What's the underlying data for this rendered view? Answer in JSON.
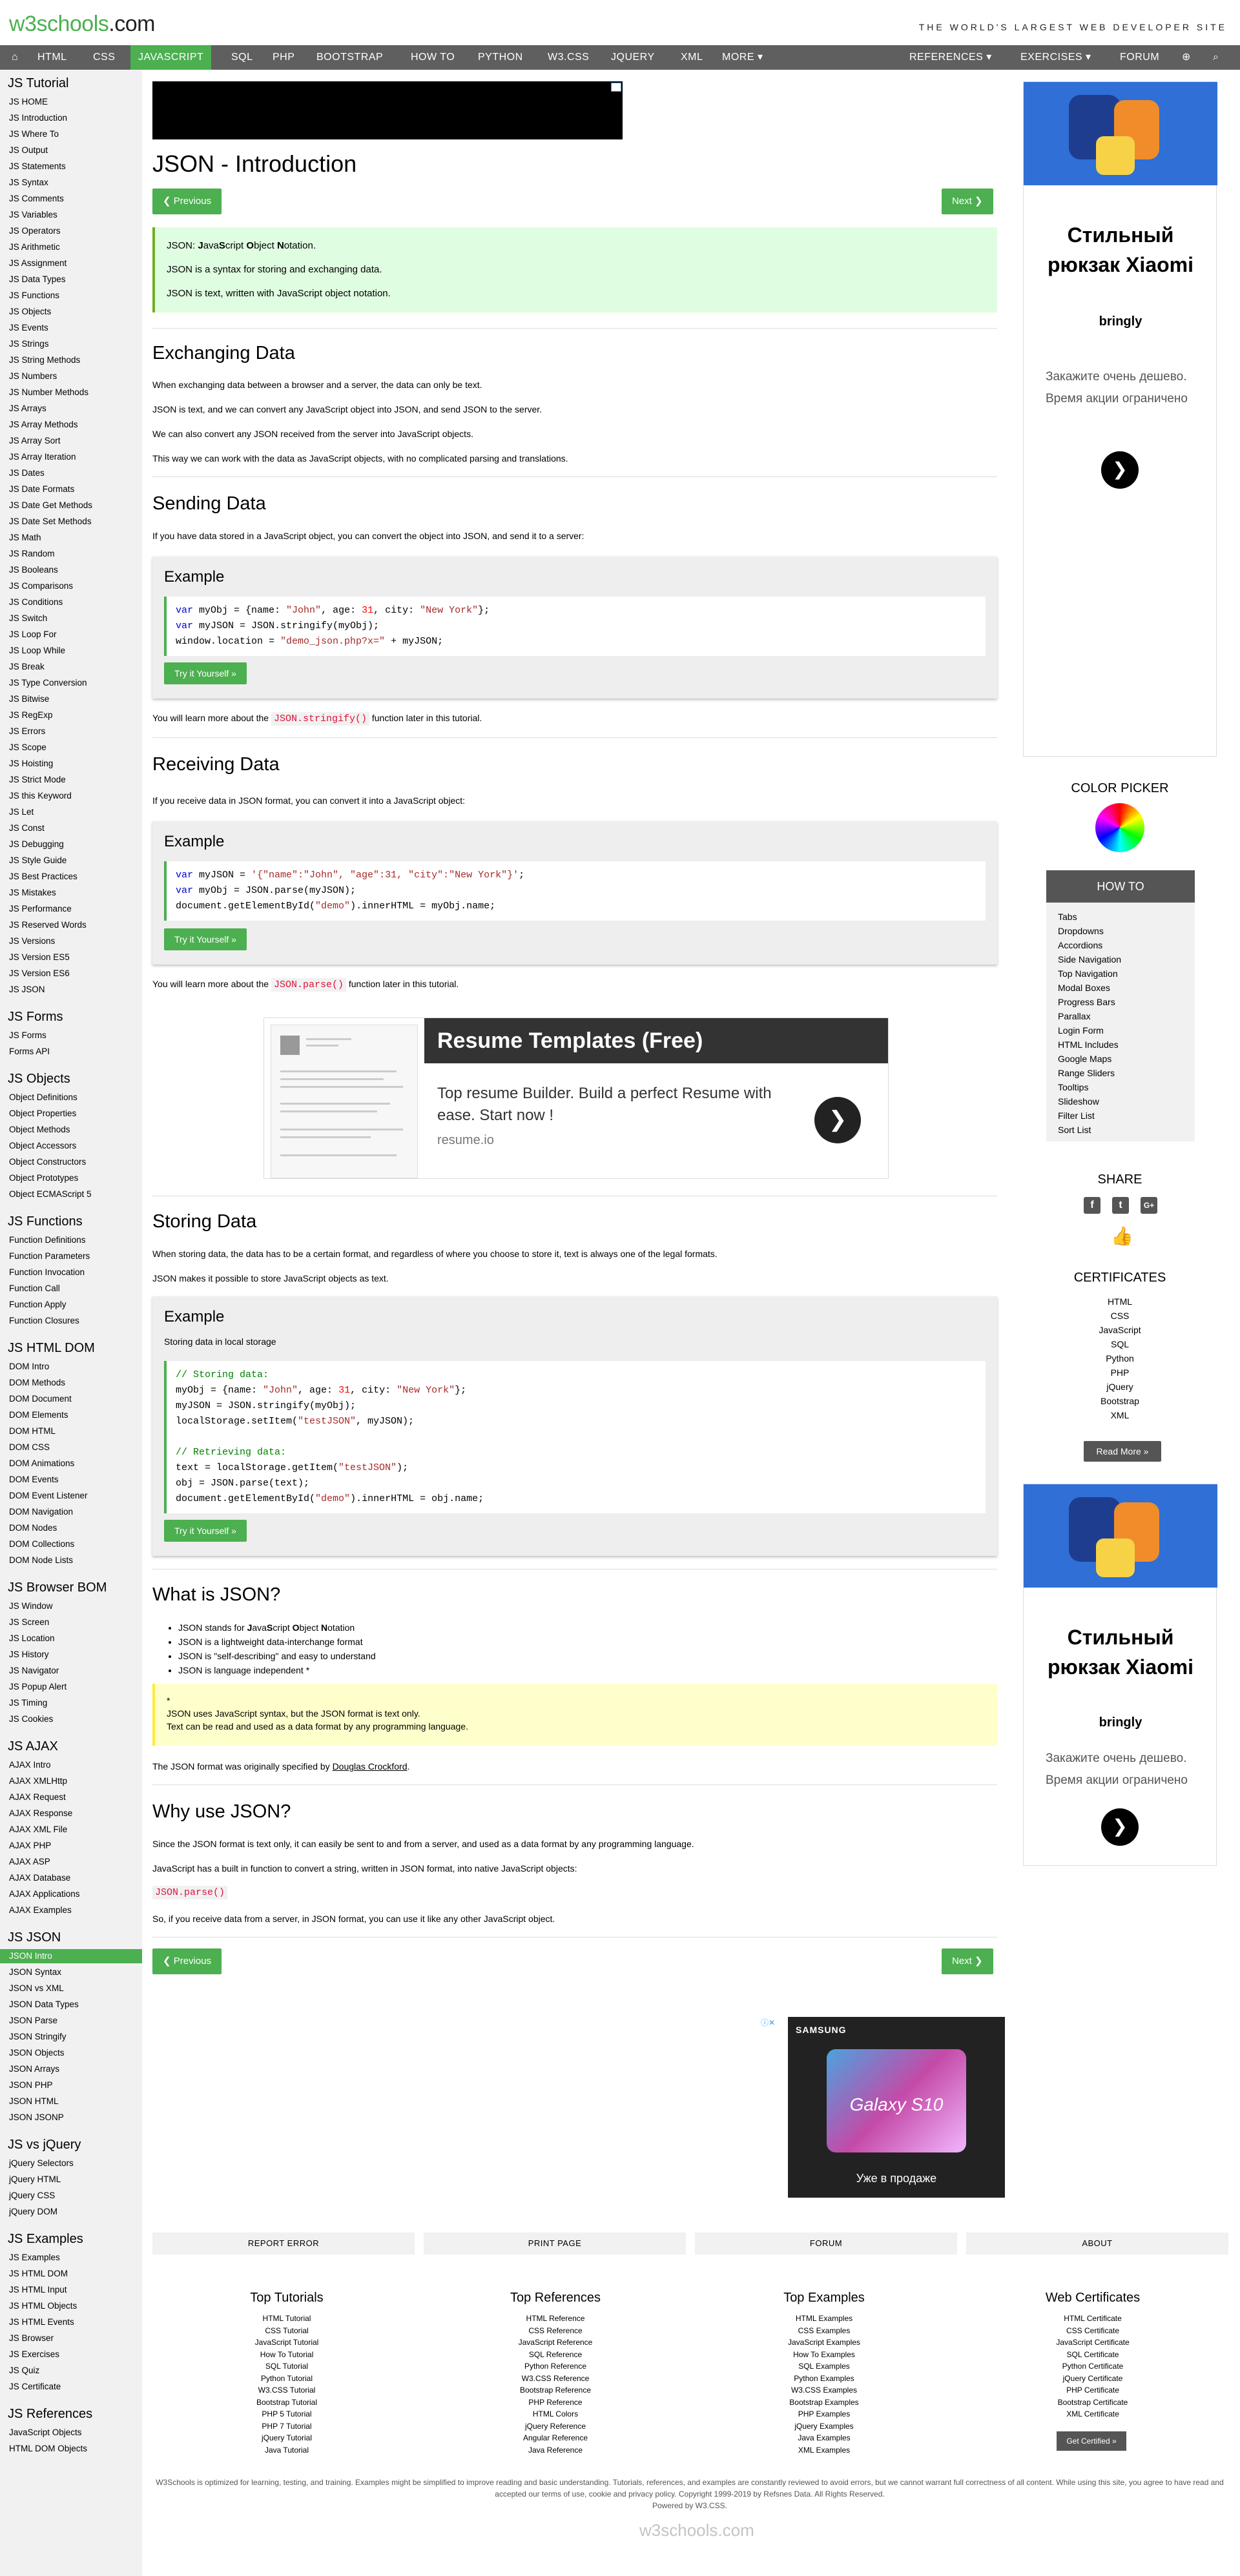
{
  "header": {
    "logo_main": "w3schools",
    "logo_suffix": ".com",
    "slogan": "THE WORLD'S LARGEST WEB DEVELOPER SITE"
  },
  "nav": {
    "home_icon": "⌂",
    "items": [
      "HTML",
      "CSS",
      "JAVASCRIPT",
      "SQL",
      "PHP",
      "BOOTSTRAP",
      "HOW TO",
      "PYTHON",
      "W3.CSS",
      "JQUERY",
      "XML",
      "MORE ▾"
    ],
    "right_items": [
      "REFERENCES ▾",
      "EXERCISES ▾",
      "FORUM"
    ],
    "globe_icon": "⊕",
    "search_icon": "⌕"
  },
  "sidebar": {
    "sections": [
      {
        "title": "JS Tutorial",
        "links": [
          "JS HOME",
          "JS Introduction",
          "JS Where To",
          "JS Output",
          "JS Statements",
          "JS Syntax",
          "JS Comments",
          "JS Variables",
          "JS Operators",
          "JS Arithmetic",
          "JS Assignment",
          "JS Data Types",
          "JS Functions",
          "JS Objects",
          "JS Events",
          "JS Strings",
          "JS String Methods",
          "JS Numbers",
          "JS Number Methods",
          "JS Arrays",
          "JS Array Methods",
          "JS Array Sort",
          "JS Array Iteration",
          "JS Dates",
          "JS Date Formats",
          "JS Date Get Methods",
          "JS Date Set Methods",
          "JS Math",
          "JS Random",
          "JS Booleans",
          "JS Comparisons",
          "JS Conditions",
          "JS Switch",
          "JS Loop For",
          "JS Loop While",
          "JS Break",
          "JS Type Conversion",
          "JS Bitwise",
          "JS RegExp",
          "JS Errors",
          "JS Scope",
          "JS Hoisting",
          "JS Strict Mode",
          "JS this Keyword",
          "JS Let",
          "JS Const",
          "JS Debugging",
          "JS Style Guide",
          "JS Best Practices",
          "JS Mistakes",
          "JS Performance",
          "JS Reserved Words",
          "JS Versions",
          "JS Version ES5",
          "JS Version ES6",
          "JS JSON"
        ]
      },
      {
        "title": "JS Forms",
        "links": [
          "JS Forms",
          "Forms API"
        ]
      },
      {
        "title": "JS Objects",
        "links": [
          "Object Definitions",
          "Object Properties",
          "Object Methods",
          "Object Accessors",
          "Object Constructors",
          "Object Prototypes",
          "Object ECMAScript 5"
        ]
      },
      {
        "title": "JS Functions",
        "links": [
          "Function Definitions",
          "Function Parameters",
          "Function Invocation",
          "Function Call",
          "Function Apply",
          "Function Closures"
        ]
      },
      {
        "title": "JS HTML DOM",
        "links": [
          "DOM Intro",
          "DOM Methods",
          "DOM Document",
          "DOM Elements",
          "DOM HTML",
          "DOM CSS",
          "DOM Animations",
          "DOM Events",
          "DOM Event Listener",
          "DOM Navigation",
          "DOM Nodes",
          "DOM Collections",
          "DOM Node Lists"
        ]
      },
      {
        "title": "JS Browser BOM",
        "links": [
          "JS Window",
          "JS Screen",
          "JS Location",
          "JS History",
          "JS Navigator",
          "JS Popup Alert",
          "JS Timing",
          "JS Cookies"
        ]
      },
      {
        "title": "JS AJAX",
        "links": [
          "AJAX Intro",
          "AJAX XMLHttp",
          "AJAX Request",
          "AJAX Response",
          "AJAX XML File",
          "AJAX PHP",
          "AJAX ASP",
          "AJAX Database",
          "AJAX Applications",
          "AJAX Examples"
        ]
      },
      {
        "title": "JS JSON",
        "links": [
          "JSON Intro",
          "JSON Syntax",
          "JSON vs XML",
          "JSON Data Types",
          "JSON Parse",
          "JSON Stringify",
          "JSON Objects",
          "JSON Arrays",
          "JSON PHP",
          "JSON HTML",
          "JSON JSONP"
        ]
      },
      {
        "title": "JS vs jQuery",
        "links": [
          "jQuery Selectors",
          "jQuery HTML",
          "jQuery CSS",
          "jQuery DOM"
        ]
      },
      {
        "title": "JS Examples",
        "links": [
          "JS Examples",
          "JS HTML DOM",
          "JS HTML Input",
          "JS HTML Objects",
          "JS HTML Events",
          "JS Browser",
          "JS Exercises",
          "JS Quiz",
          "JS Certificate"
        ]
      },
      {
        "title": "JS References",
        "links": [
          "JavaScript Objects",
          "HTML DOM Objects"
        ]
      }
    ],
    "active": "JSON Intro"
  },
  "main": {
    "title": "JSON - Introduction",
    "prev": "❮ Previous",
    "next": "Next ❯",
    "note": {
      "line1_parts": [
        "JSON: ",
        "J",
        "ava",
        "S",
        "cript ",
        "O",
        "bject ",
        "N",
        "otation."
      ],
      "line2": "JSON is a syntax for storing and exchanging data.",
      "line3": "JSON is text, written with JavaScript object notation."
    },
    "exchanging": {
      "title": "Exchanging Data",
      "p1": "When exchanging data between a browser and a server, the data can only be text.",
      "p2": "JSON is text, and we can convert any JavaScript object into JSON, and send JSON to the server.",
      "p3": "We can also convert any JSON received from the server into JavaScript objects.",
      "p4": "This way we can work with the data as JavaScript objects, with no complicated parsing and translations."
    },
    "sending": {
      "title": "Sending Data",
      "p1": "If you have data stored in a JavaScript object, you can convert the object into JSON, and send it to a server:",
      "example_title": "Example",
      "try": "Try it Yourself »",
      "after_pre": "You will learn more about the ",
      "after_code": "JSON.stringify()",
      "after_post": " function later in this tutorial."
    },
    "receiving": {
      "title": "Receiving Data",
      "p1": "If you receive data in JSON format, you can convert it into a JavaScript object:",
      "example_title": "Example",
      "try": "Try it Yourself »",
      "after_pre": "You will learn more about the ",
      "after_code": "JSON.parse()",
      "after_post": " function later in this tutorial."
    },
    "resume_ad": {
      "title": "Resume Templates (Free)",
      "body": "Top resume Builder. Build a perfect Resume with ease. Start now !",
      "domain": "resume.io",
      "go": "❯"
    },
    "storing": {
      "title": "Storing Data",
      "p1": "When storing data, the data has to be a certain format, and regardless of where you choose to store it, text is always one of the legal formats.",
      "p2": "JSON makes it possible to store JavaScript objects as text.",
      "example_title": "Example",
      "example_desc": "Storing data in local storage",
      "try": "Try it Yourself »"
    },
    "what": {
      "title": "What is JSON?",
      "b1_parts": [
        "JSON stands for ",
        "J",
        "ava",
        "S",
        "cript ",
        "O",
        "bject ",
        "N",
        "otation"
      ],
      "b2": "JSON is a lightweight data-interchange format",
      "b3": "JSON is \"self-describing\" and easy to understand",
      "b4": "JSON is language independent *",
      "note_star": "*",
      "note_l1": "JSON uses JavaScript syntax, but the JSON format is text only.",
      "note_l2": "Text can be read and used as a data format by any programming language.",
      "spec_pre": "The JSON format was originally specified by ",
      "spec_link": "Douglas Crockford",
      "spec_post": "."
    },
    "why": {
      "title": "Why use JSON?",
      "p1": "Since the JSON format is text only, it can easily be sent to and from a server, and used as a data format by any programming language.",
      "p2": "JavaScript has a built in function to convert a string, written in JSON format, into native JavaScript objects:",
      "code": "JSON.parse()",
      "p3": "So, if you receive data from a server, in JSON format, you can use it like any other JavaScript object."
    },
    "samsung_ad": {
      "brand": "SAMSUNG",
      "model": "Galaxy S10",
      "sale": "Уже в продаже"
    }
  },
  "right": {
    "ad": {
      "title_l1": "Стильный",
      "title_l2": "рюкзак Xiaomi",
      "brand": "bringly",
      "text_l1": "Закажите очень дешево.",
      "text_l2": "Время акции ограничено",
      "go": "❯"
    },
    "color_picker": "COLOR PICKER",
    "howto_title": "HOW TO",
    "howto_links": [
      "Tabs",
      "Dropdowns",
      "Accordions",
      "Side Navigation",
      "Top Navigation",
      "Modal Boxes",
      "Progress Bars",
      "Parallax",
      "Login Form",
      "HTML Includes",
      "Google Maps",
      "Range Sliders",
      "Tooltips",
      "Slideshow",
      "Filter List",
      "Sort List"
    ],
    "share": "SHARE",
    "share_icons": [
      "f",
      "t",
      "G+"
    ],
    "like_icon": "👍",
    "certificates": "CERTIFICATES",
    "cert_links": [
      "HTML",
      "CSS",
      "JavaScript",
      "SQL",
      "Python",
      "PHP",
      "jQuery",
      "Bootstrap",
      "XML"
    ],
    "read_more": "Read More »"
  },
  "footer": {
    "buttons": [
      "REPORT ERROR",
      "PRINT PAGE",
      "FORUM",
      "ABOUT"
    ],
    "cols": [
      {
        "title": "Top Tutorials",
        "links": [
          "HTML Tutorial",
          "CSS Tutorial",
          "JavaScript Tutorial",
          "How To Tutorial",
          "SQL Tutorial",
          "Python Tutorial",
          "W3.CSS Tutorial",
          "Bootstrap Tutorial",
          "PHP 5 Tutorial",
          "PHP 7 Tutorial",
          "jQuery Tutorial",
          "Java Tutorial"
        ]
      },
      {
        "title": "Top References",
        "links": [
          "HTML Reference",
          "CSS Reference",
          "JavaScript Reference",
          "SQL Reference",
          "Python Reference",
          "W3.CSS Reference",
          "Bootstrap Reference",
          "PHP Reference",
          "HTML Colors",
          "jQuery Reference",
          "Angular Reference",
          "Java Reference"
        ]
      },
      {
        "title": "Top Examples",
        "links": [
          "HTML Examples",
          "CSS Examples",
          "JavaScript Examples",
          "How To Examples",
          "SQL Examples",
          "Python Examples",
          "W3.CSS Examples",
          "Bootstrap Examples",
          "PHP Examples",
          "jQuery Examples",
          "Java Examples",
          "XML Examples"
        ]
      },
      {
        "title": "Web Certificates",
        "links": [
          "HTML Certificate",
          "CSS Certificate",
          "JavaScript Certificate",
          "SQL Certificate",
          "Python Certificate",
          "jQuery Certificate",
          "PHP Certificate",
          "Bootstrap Certificate",
          "XML Certificate"
        ]
      }
    ],
    "get_certified": "Get Certified »",
    "disclaimer_l1": "W3Schools is optimized for learning, testing, and training. Examples might be simplified to improve reading and basic understanding. Tutorials, references, and examples are constantly reviewed to avoid errors, but we cannot warrant full correctness of all content. While using this site, you agree to have read and",
    "disclaimer_l2": "accepted our terms of use, cookie and privacy policy. Copyright 1999-2019 by Refsnes Data. All Rights Reserved.",
    "disclaimer_l3": "Powered by W3.CSS.",
    "logo": "w3schools.com"
  },
  "colors": {
    "green": "#4CAF50",
    "nav_gray": "#5f5f5f",
    "sidebar_bg": "#f1f1f1",
    "note_green_bg": "#dffde0",
    "note_yellow_bg": "#ffffcc"
  }
}
